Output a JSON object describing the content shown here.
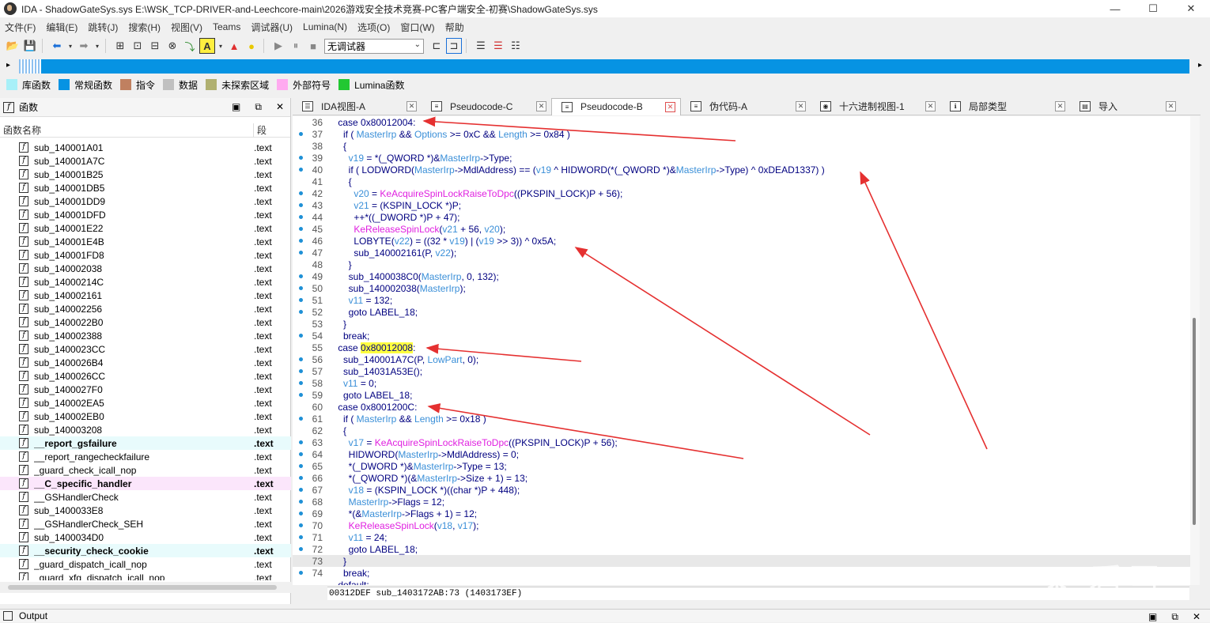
{
  "window": {
    "title": "IDA - ShadowGateSys.sys E:\\WSK_TCP-DRIVER-and-Leechcore-main\\2026游戏安全技术竞赛-PC客户端安全-初赛\\ShadowGateSys.sys",
    "minimize": "—",
    "maximize": "☐",
    "close": "✕"
  },
  "menu": [
    "文件(F)",
    "编辑(E)",
    "跳转(J)",
    "搜索(H)",
    "视图(V)",
    "Teams",
    "调试器(U)",
    "Lumina(N)",
    "选项(O)",
    "窗口(W)",
    "帮助"
  ],
  "toolbar": {
    "debugger_value": "无调试器"
  },
  "legend": [
    {
      "label": "库函数",
      "color": "#a8f0f8"
    },
    {
      "label": "常规函数",
      "color": "#0693e3"
    },
    {
      "label": "指令",
      "color": "#c08060"
    },
    {
      "label": "数据",
      "color": "#c0c0c0"
    },
    {
      "label": "未探索区域",
      "color": "#b0b070"
    },
    {
      "label": "外部符号",
      "color": "#ffaaf0"
    },
    {
      "label": "Lumina函数",
      "color": "#22c832"
    }
  ],
  "functions_panel": {
    "title": "函数",
    "col_name": "函数名称",
    "col_segment": "段",
    "rows": [
      {
        "name": "sub_140001A01",
        "seg": ".text",
        "kind": "normal"
      },
      {
        "name": "sub_140001A7C",
        "seg": ".text",
        "kind": "normal"
      },
      {
        "name": "sub_140001B25",
        "seg": ".text",
        "kind": "normal"
      },
      {
        "name": "sub_140001DB5",
        "seg": ".text",
        "kind": "normal"
      },
      {
        "name": "sub_140001DD9",
        "seg": ".text",
        "kind": "normal"
      },
      {
        "name": "sub_140001DFD",
        "seg": ".text",
        "kind": "normal"
      },
      {
        "name": "sub_140001E22",
        "seg": ".text",
        "kind": "normal"
      },
      {
        "name": "sub_140001E4B",
        "seg": ".text",
        "kind": "normal"
      },
      {
        "name": "sub_140001FD8",
        "seg": ".text",
        "kind": "normal"
      },
      {
        "name": "sub_140002038",
        "seg": ".text",
        "kind": "normal"
      },
      {
        "name": "sub_14000214C",
        "seg": ".text",
        "kind": "normal"
      },
      {
        "name": "sub_140002161",
        "seg": ".text",
        "kind": "normal"
      },
      {
        "name": "sub_140002256",
        "seg": ".text",
        "kind": "normal"
      },
      {
        "name": "sub_1400022B0",
        "seg": ".text",
        "kind": "normal"
      },
      {
        "name": "sub_140002388",
        "seg": ".text",
        "kind": "normal"
      },
      {
        "name": "sub_1400023CC",
        "seg": ".text",
        "kind": "normal"
      },
      {
        "name": "sub_1400026B4",
        "seg": ".text",
        "kind": "normal"
      },
      {
        "name": "sub_1400026CC",
        "seg": ".text",
        "kind": "normal"
      },
      {
        "name": "sub_1400027F0",
        "seg": ".text",
        "kind": "normal"
      },
      {
        "name": "sub_140002EA5",
        "seg": ".text",
        "kind": "normal"
      },
      {
        "name": "sub_140002EB0",
        "seg": ".text",
        "kind": "normal"
      },
      {
        "name": "sub_140003208",
        "seg": ".text",
        "kind": "normal"
      },
      {
        "name": "__report_gsfailure",
        "seg": ".text",
        "kind": "lib"
      },
      {
        "name": "__report_rangecheckfailure",
        "seg": ".text",
        "kind": "normal"
      },
      {
        "name": "_guard_check_icall_nop",
        "seg": ".text",
        "kind": "normal"
      },
      {
        "name": "__C_specific_handler",
        "seg": ".text",
        "kind": "ext"
      },
      {
        "name": "__GSHandlerCheck",
        "seg": ".text",
        "kind": "normal"
      },
      {
        "name": "sub_1400033E8",
        "seg": ".text",
        "kind": "normal"
      },
      {
        "name": "__GSHandlerCheck_SEH",
        "seg": ".text",
        "kind": "normal"
      },
      {
        "name": "sub_1400034D0",
        "seg": ".text",
        "kind": "normal"
      },
      {
        "name": "__security_check_cookie",
        "seg": ".text",
        "kind": "lib"
      },
      {
        "name": "_guard_dispatch_icall_nop",
        "seg": ".text",
        "kind": "normal"
      },
      {
        "name": "_guard_xfg_dispatch_icall_nop",
        "seg": ".text",
        "kind": "normal"
      }
    ]
  },
  "tabs": [
    {
      "label": "IDA视图-A",
      "icon": "ida-view-icon",
      "active": false
    },
    {
      "label": "Pseudocode-C",
      "icon": "pseudocode-icon",
      "active": false
    },
    {
      "label": "Pseudocode-B",
      "icon": "pseudocode-icon",
      "active": true
    },
    {
      "label": "伪代码-A",
      "icon": "pseudocode-icon",
      "active": false
    },
    {
      "label": "十六进制视图-1",
      "icon": "hex-view-icon",
      "active": false
    },
    {
      "label": "局部类型",
      "icon": "local-types-icon",
      "active": false
    },
    {
      "label": "导入",
      "icon": "imports-icon",
      "active": false
    }
  ],
  "code": [
    {
      "ln": "36",
      "dot": false,
      "html": "    case 0x80012004:"
    },
    {
      "ln": "37",
      "dot": true,
      "html": "      if ( <span class=\"v\">MasterIrp</span> &amp;&amp; <span class=\"v\">Options</span> &gt;= 0xC &amp;&amp; <span class=\"v\">Length</span> &gt;= 0x84 )"
    },
    {
      "ln": "38",
      "dot": false,
      "html": "      {"
    },
    {
      "ln": "39",
      "dot": true,
      "html": "        <span class=\"v\">v19</span> = *(_QWORD *)&amp;<span class=\"v\">MasterIrp</span>-&gt;Type;"
    },
    {
      "ln": "40",
      "dot": true,
      "html": "        if ( LODWORD(<span class=\"v\">MasterIrp</span>-&gt;MdlAddress) == (<span class=\"v\">v19</span> ^ HIDWORD(*(_QWORD *)&amp;<span class=\"v\">MasterIrp</span>-&gt;Type) ^ 0xDEAD1337) )"
    },
    {
      "ln": "41",
      "dot": false,
      "html": "        {"
    },
    {
      "ln": "42",
      "dot": true,
      "html": "          <span class=\"v\">v20</span> = <span class=\"f\">KeAcquireSpinLockRaiseToDpc</span>((PKSPIN_LOCK)P + 56);"
    },
    {
      "ln": "43",
      "dot": true,
      "html": "          <span class=\"v\">v21</span> = (KSPIN_LOCK *)P;"
    },
    {
      "ln": "44",
      "dot": true,
      "html": "          ++*((_DWORD *)P + 47);"
    },
    {
      "ln": "45",
      "dot": true,
      "html": "          <span class=\"f\">KeReleaseSpinLock</span>(<span class=\"v\">v21</span> + 56, <span class=\"v\">v20</span>);"
    },
    {
      "ln": "46",
      "dot": true,
      "html": "          LOBYTE(<span class=\"v\">v22</span>) = ((32 * <span class=\"v\">v19</span>) | (<span class=\"v\">v19</span> &gt;&gt; 3)) ^ 0x5A;"
    },
    {
      "ln": "47",
      "dot": true,
      "html": "          sub_140002161(P, <span class=\"v\">v22</span>);"
    },
    {
      "ln": "48",
      "dot": false,
      "html": "        }"
    },
    {
      "ln": "49",
      "dot": true,
      "html": "        sub_1400038C0(<span class=\"v\">MasterIrp</span>, 0, 132);"
    },
    {
      "ln": "50",
      "dot": true,
      "html": "        sub_140002038(<span class=\"v\">MasterIrp</span>);"
    },
    {
      "ln": "51",
      "dot": true,
      "html": "        <span class=\"v\">v11</span> = 132;"
    },
    {
      "ln": "52",
      "dot": true,
      "html": "        goto LABEL_18;"
    },
    {
      "ln": "53",
      "dot": false,
      "html": "      }"
    },
    {
      "ln": "54",
      "dot": true,
      "html": "      break;"
    },
    {
      "ln": "55",
      "dot": false,
      "html": "    case <span class=\"yellowhl\">0x80012008</span>:"
    },
    {
      "ln": "56",
      "dot": true,
      "html": "      sub_140001A7C(P, <span class=\"v\">LowPart</span>, 0);"
    },
    {
      "ln": "57",
      "dot": true,
      "html": "      sub_14031A53E();"
    },
    {
      "ln": "58",
      "dot": true,
      "html": "      <span class=\"v\">v11</span> = 0;"
    },
    {
      "ln": "59",
      "dot": true,
      "html": "      goto LABEL_18;"
    },
    {
      "ln": "60",
      "dot": false,
      "html": "    case 0x8001200C:"
    },
    {
      "ln": "61",
      "dot": true,
      "html": "      if ( <span class=\"v\">MasterIrp</span> &amp;&amp; <span class=\"v\">Length</span> &gt;= 0x18 )"
    },
    {
      "ln": "62",
      "dot": false,
      "html": "      {"
    },
    {
      "ln": "63",
      "dot": true,
      "html": "        <span class=\"v\">v17</span> = <span class=\"f\">KeAcquireSpinLockRaiseToDpc</span>((PKSPIN_LOCK)P + 56);"
    },
    {
      "ln": "64",
      "dot": true,
      "html": "        HIDWORD(<span class=\"v\">MasterIrp</span>-&gt;MdlAddress) = 0;"
    },
    {
      "ln": "65",
      "dot": true,
      "html": "        *(_DWORD *)&amp;<span class=\"v\">MasterIrp</span>-&gt;Type = 13;"
    },
    {
      "ln": "66",
      "dot": true,
      "html": "        *(_QWORD *)(&amp;<span class=\"v\">MasterIrp</span>-&gt;Size + 1) = 13;"
    },
    {
      "ln": "67",
      "dot": true,
      "html": "        <span class=\"v\">v18</span> = (KSPIN_LOCK *)((char *)P + 448);"
    },
    {
      "ln": "68",
      "dot": true,
      "html": "        <span class=\"v\">MasterIrp</span>-&gt;Flags = 12;"
    },
    {
      "ln": "69",
      "dot": true,
      "html": "        *(&amp;<span class=\"v\">MasterIrp</span>-&gt;Flags + 1) = 12;"
    },
    {
      "ln": "70",
      "dot": true,
      "html": "        <span class=\"f\">KeReleaseSpinLock</span>(<span class=\"v\">v18</span>, <span class=\"v\">v17</span>);"
    },
    {
      "ln": "71",
      "dot": true,
      "html": "        <span class=\"v\">v11</span> = 24;"
    },
    {
      "ln": "72",
      "dot": true,
      "html": "        goto LABEL_18;"
    },
    {
      "ln": "73",
      "dot": false,
      "html": "      }",
      "hl": true
    },
    {
      "ln": "74",
      "dot": true,
      "html": "      break;"
    },
    {
      "ln": "",
      "dot": false,
      "html": "    default:"
    }
  ],
  "status_line": "00312DEF sub_1403172AB:73 (1403173EF)",
  "output_panel": {
    "title": "Output"
  },
  "watermark": "❋ 看雪"
}
